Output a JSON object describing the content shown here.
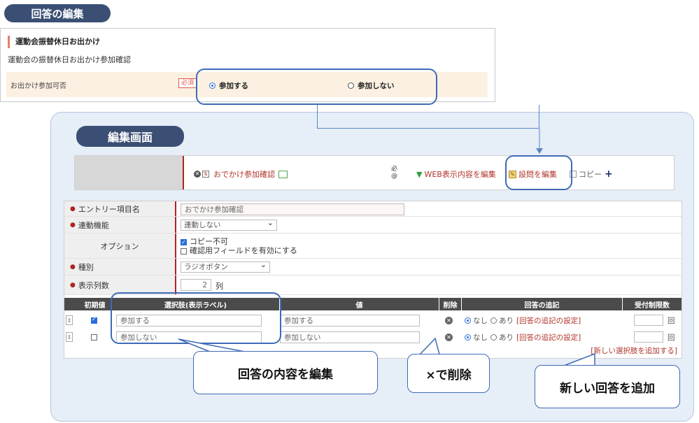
{
  "top_pill": "回答の編集",
  "preview": {
    "heading": "運動会振替休日お出かけ",
    "description": "運動会の振替休日お出かけ参加確認",
    "row_label": "お出かけ参加可否",
    "required_badge": "必須",
    "options": [
      {
        "label": "参加する",
        "selected": true
      },
      {
        "label": "参加しない",
        "selected": false
      }
    ]
  },
  "edit_pill": "編集画面",
  "toolbar": {
    "item_title": "おでかけ参加確認",
    "mark_top": "必",
    "mark_bottom": "@",
    "web_edit": "WEB表示内容を編集",
    "question_edit": "設問を編集",
    "copy": "コピー",
    "add": "+"
  },
  "form": {
    "entry_label": "エントリー項目名",
    "entry_value": "おでかけ参加確認",
    "link_label": "連動機能",
    "link_value": "連動しない",
    "options_label": "オプション",
    "option_copy": "コピー不可",
    "option_confirm": "確認用フィールドを有効にする",
    "type_label": "種別",
    "type_value": "ラジオボタン",
    "columns_label": "表示列数",
    "columns_value": "2",
    "columns_unit": "列"
  },
  "table": {
    "headers": [
      "初期値",
      "選択肢(表示ラベル)",
      "値",
      "削除",
      "回答の追記",
      "受付制限数"
    ],
    "rows": [
      {
        "checked": true,
        "label": "参加する",
        "value": "参加する"
      },
      {
        "checked": false,
        "label": "参加しない",
        "value": "参加しない"
      }
    ],
    "none_label": "なし",
    "yes_label": "あり",
    "append_link": "[回答の追記の設定]",
    "limit_unit": "回",
    "add_option_link": "[新しい選択肢を追加する]"
  },
  "callouts": {
    "edit": "回答の内容を編集",
    "delete": "×で削除",
    "add": "新しい回答を追加"
  },
  "colors": {
    "pill": "#3a4f73",
    "highlight": "#3f6bb5",
    "panel": "#e6eef8",
    "link_red": "#b0342a"
  }
}
